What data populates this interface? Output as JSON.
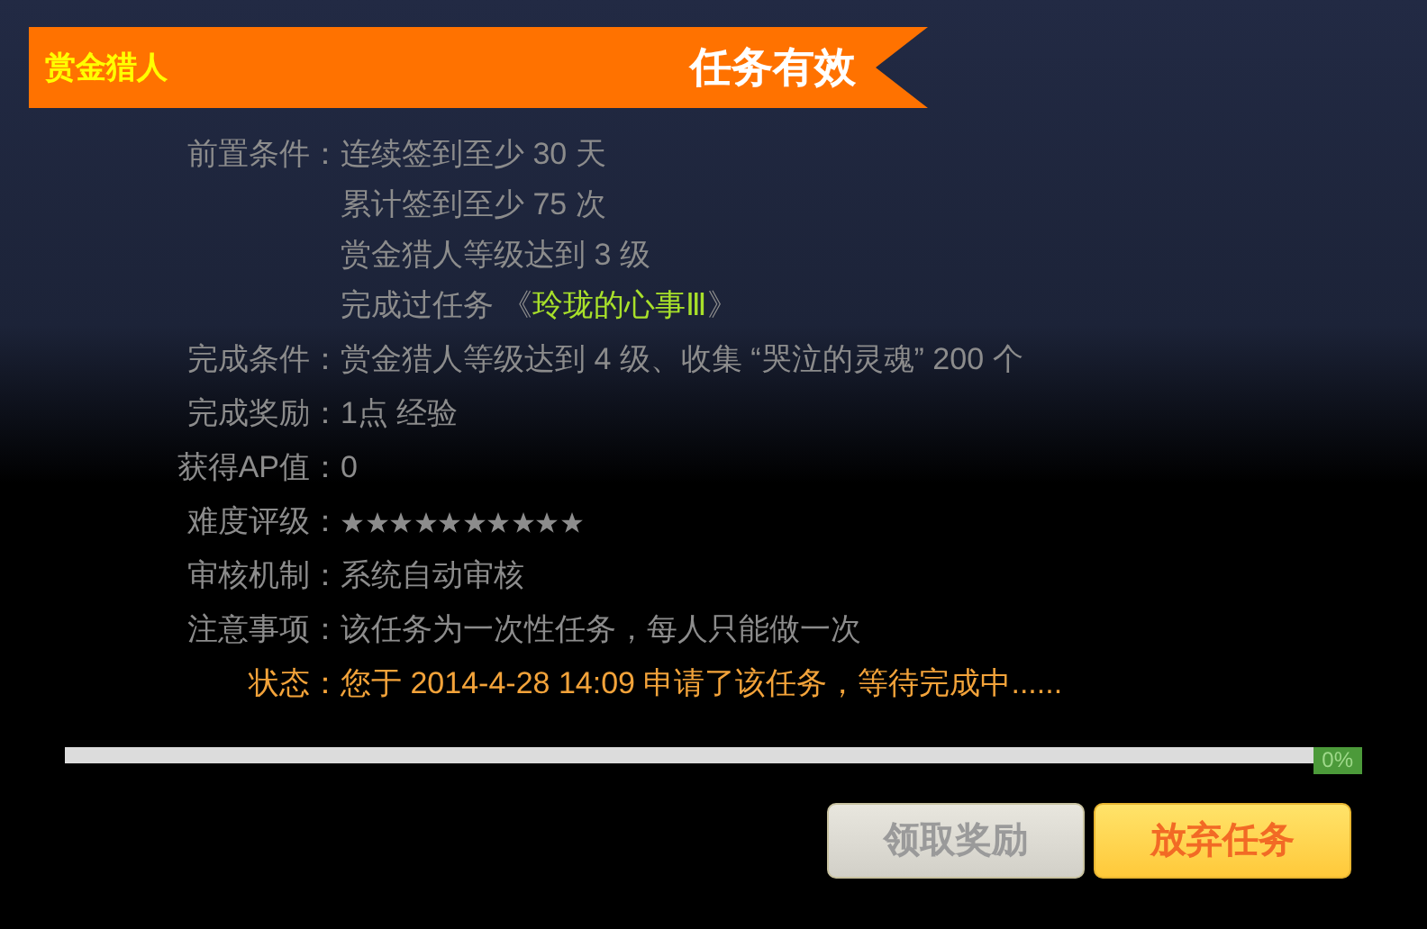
{
  "banner": {
    "title": "赏金猎人",
    "status": "任务有效"
  },
  "details": [
    {
      "label": "前置条件：",
      "kind": "plain",
      "lines": [
        [
          {
            "text": "连续签到至少 30 天",
            "kind": "plain"
          }
        ],
        [
          {
            "text": "累计签到至少 75 次",
            "kind": "plain"
          }
        ],
        [
          {
            "text": "赏金猎人等级达到 3 级",
            "kind": "plain"
          }
        ],
        [
          {
            "text": "完成过任务 《",
            "kind": "plain"
          },
          {
            "text": "玲珑的心事Ⅲ",
            "kind": "highlight"
          },
          {
            "text": "》",
            "kind": "plain"
          }
        ]
      ]
    },
    {
      "label": "完成条件：",
      "kind": "plain",
      "lines": [
        [
          {
            "text": "赏金猎人等级达到 4 级、收集 “哭泣的灵魂” 200 个",
            "kind": "plain"
          }
        ]
      ]
    },
    {
      "label": "完成奖励：",
      "kind": "plain",
      "lines": [
        [
          {
            "text": "1点 经验",
            "kind": "plain"
          }
        ]
      ]
    },
    {
      "label": "获得AP值：",
      "kind": "plain",
      "lines": [
        [
          {
            "text": "0",
            "kind": "plain"
          }
        ]
      ]
    },
    {
      "label": "难度评级：",
      "kind": "stars",
      "stars": 10
    },
    {
      "label": "审核机制：",
      "kind": "plain",
      "lines": [
        [
          {
            "text": "系统自动审核",
            "kind": "plain"
          }
        ]
      ]
    },
    {
      "label": "注意事项：",
      "kind": "plain",
      "lines": [
        [
          {
            "text": "该任务为一次性任务，每人只能做一次",
            "kind": "plain"
          }
        ]
      ]
    },
    {
      "label": "状态：",
      "kind": "status",
      "lines": [
        [
          {
            "text": "您于 2014-4-28 14:09 申请了该任务，等待完成中......",
            "kind": "plain"
          }
        ]
      ]
    }
  ],
  "progress": {
    "level": 0,
    "reading": "0%"
  },
  "buttons": [
    {
      "label": "领取奖励",
      "disabled": true
    },
    {
      "label": "放弃任务",
      "disabled": false
    }
  ]
}
